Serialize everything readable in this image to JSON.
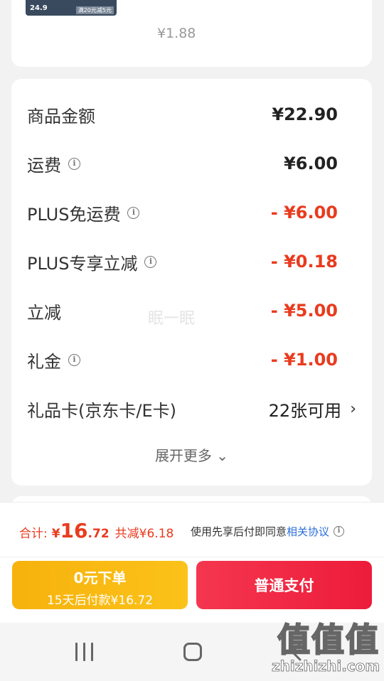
{
  "top_card": {
    "thumb_price": "24.9",
    "thumb_coupon": "满20元减5元",
    "faded_price": "¥1.88"
  },
  "summary": {
    "rows": [
      {
        "label": "商品金额",
        "value": "¥22.90",
        "has_info": false
      },
      {
        "label": "运费",
        "value": "¥6.00",
        "has_info": true
      },
      {
        "label": "PLUS免运费",
        "value": "- ¥6.00",
        "has_info": true
      },
      {
        "label": "PLUS专享立减",
        "value": "- ¥0.18",
        "has_info": true
      },
      {
        "label": "立减",
        "value": "- ¥5.00",
        "has_info": false
      },
      {
        "label": "礼金",
        "value": "- ¥1.00",
        "has_info": true
      }
    ],
    "gift_card": {
      "label": "礼品卡(京东卡/E卡)",
      "value": "22张可用"
    },
    "expand_label": "展开更多",
    "watermark": "眠一眠"
  },
  "bottom_bar": {
    "total_label": "合计:",
    "total_yen": "¥",
    "total_int": "16",
    "total_dec": ".72",
    "saved": "共减¥6.18",
    "agree_text": "使用先享后付即同意",
    "agree_link": "相关协议",
    "left_button": {
      "main": "0元下单",
      "sub": "15天后付款¥16.72"
    },
    "right_button": "普通支付"
  },
  "brand": {
    "logo": "值值值",
    "url": "zhizhizhi.com"
  },
  "colors": {
    "accent_red": "#e93b1e",
    "pay_red": "#ec1c3a",
    "pay_yellow": "#f7b20c",
    "link_blue": "#2b6fdb"
  },
  "icons": [
    "info-icon",
    "chevron-right-icon",
    "chevron-down-icon",
    "recents-icon",
    "home-icon",
    "back-icon"
  ]
}
